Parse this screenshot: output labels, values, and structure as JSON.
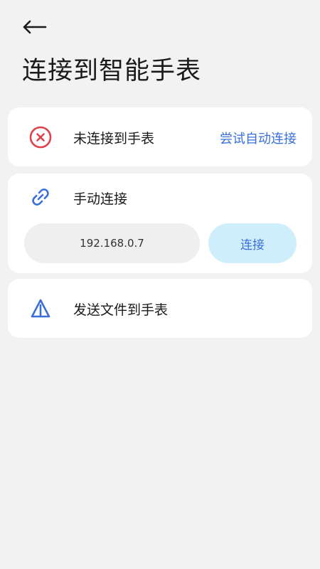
{
  "header": {
    "back_icon": "arrow-left-icon",
    "title": "连接到智能手表"
  },
  "status_card": {
    "icon": "disconnected-x-icon",
    "label": "未连接到手表",
    "action": "尝试自动连接"
  },
  "manual_card": {
    "icon": "link-icon",
    "label": "手动连接",
    "ip_value": "192.168.0.7",
    "connect_label": "连接"
  },
  "send_card": {
    "icon": "send-triangle-icon",
    "label": "发送文件到手表"
  },
  "colors": {
    "background": "#f2f2f2",
    "card": "#ffffff",
    "accent": "#3a6fd8",
    "error": "#e0424a",
    "connect_button_bg": "#cfeefb"
  }
}
